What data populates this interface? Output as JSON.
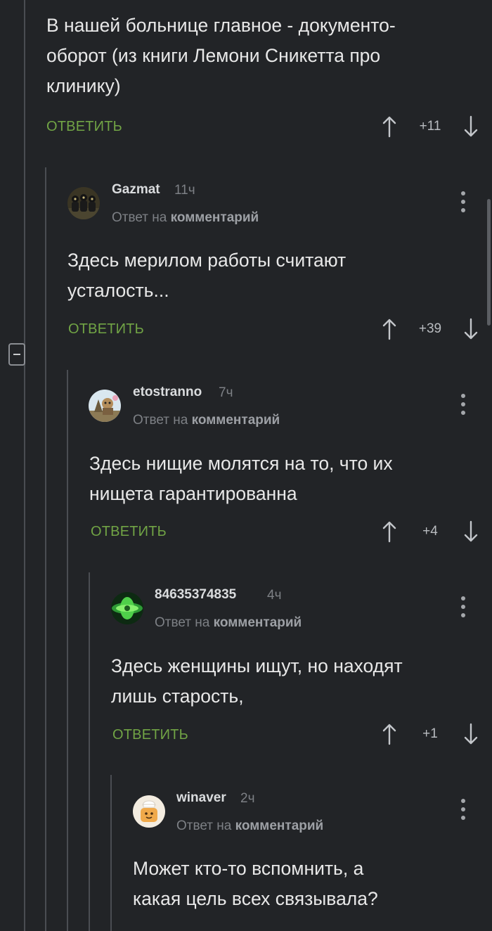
{
  "common": {
    "reply_label": "ОТВЕТИТЬ",
    "reply_to_prefix": "Ответ на ",
    "reply_to_link": "комментарий"
  },
  "comments": [
    {
      "text": "В нашей больнице главное - документо-\nоборот (из книги Лемони Сникетта про\nклинику)",
      "score": "+11"
    },
    {
      "username": "Gazmat",
      "time": "11ч",
      "text": "Здесь мерилом работы считают\nусталость...",
      "score": "+39"
    },
    {
      "username": "etostranno",
      "time": "7ч",
      "text": "Здесь нищие молятся на то, что их\nнищета гарантированна",
      "score": "+4"
    },
    {
      "username": "84635374835",
      "time": "4ч",
      "text": "Здесь женщины ищут, но находят\nлишь старость,",
      "score": "+1"
    },
    {
      "username": "winaver",
      "time": "2ч",
      "text": "Может кто-то вспомнить, а\nкакая цель всех связывала?"
    }
  ],
  "colors": {
    "background": "#222427",
    "reply_accent": "#71a445",
    "thread_line": "#4a4d52",
    "text": "#e8e8e8",
    "muted": "#7d8085"
  },
  "icons": [
    "up-arrow-icon",
    "down-arrow-icon",
    "more-vertical-icon",
    "collapse-minus-icon"
  ]
}
